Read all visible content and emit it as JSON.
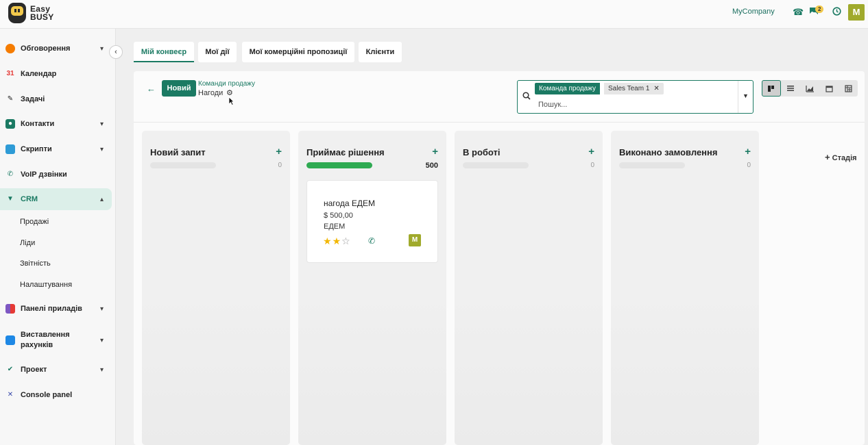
{
  "brand": {
    "line1": "Easy",
    "line2": "BUSY"
  },
  "topbar": {
    "company": "MyCompany",
    "messages_count": "2",
    "avatar": "M"
  },
  "sidebar": {
    "items": [
      {
        "label": "Обговорення",
        "icon": "chat-bubble-icon",
        "color": "#f57c00",
        "chevron": "⌄"
      },
      {
        "label": "Календар",
        "icon": "calendar-icon",
        "color": "#e53935",
        "chevron": ""
      },
      {
        "label": "Задачі",
        "icon": "pen-icon",
        "color": "#1a1a1a",
        "chevron": ""
      },
      {
        "label": "Контакти",
        "icon": "contacts-icon",
        "color": "#1b7a63",
        "chevron": "⌄"
      },
      {
        "label": "Скрипти",
        "icon": "scripts-icon",
        "color": "#2e9bd6",
        "chevron": "⌄"
      },
      {
        "label": "VoIP дзвінки",
        "icon": "phone-icon",
        "color": "#1b7a63",
        "chevron": ""
      },
      {
        "label": "CRM",
        "icon": "crm-icon",
        "color": "#1b7a63",
        "chevron": "⌃"
      },
      {
        "label": "Панелі приладів",
        "icon": "dashboard-icon",
        "color": "#7e57c2",
        "chevron": "⌄"
      },
      {
        "label": "Виставлення",
        "label2": "рахунків",
        "icon": "invoice-icon",
        "color": "#1e88e5",
        "chevron": "⌄"
      },
      {
        "label": "Проект",
        "icon": "check-icon",
        "color": "#1b7a63",
        "chevron": "⌄"
      },
      {
        "label": "Console panel",
        "icon": "tools-icon",
        "color": "#3949ab",
        "chevron": ""
      }
    ],
    "crm_sub": [
      "Продажі",
      "Ліди",
      "Звітність",
      "Налаштування"
    ]
  },
  "tabs": [
    "Мій конвеєр",
    "Мої дії",
    "Мої комерційні пропозиції",
    "Клієнти"
  ],
  "control": {
    "new_label": "Новий",
    "breadcrumb_parent": "Команди продажу",
    "breadcrumb_current": "Нагоди"
  },
  "search": {
    "facet_label": "Команда продажу",
    "facet_value": "Sales Team 1",
    "placeholder": "Пошук..."
  },
  "views": [
    "kanban-view-icon",
    "list-view-icon",
    "graph-view-icon",
    "calendar-view-icon",
    "pivot-view-icon"
  ],
  "columns": [
    {
      "title": "Новий запит",
      "total": "0",
      "progress": 0
    },
    {
      "title": "Приймає рішення",
      "total": "500",
      "progress": 1.0
    },
    {
      "title": "В роботі",
      "total": "0",
      "progress": 0
    },
    {
      "title": "Виконано замовлення",
      "total": "0",
      "progress": 0
    }
  ],
  "card": {
    "title": "нагода ЕДЕМ",
    "amount": "$ 500,00",
    "customer": "ЕДЕМ",
    "stars": 2,
    "stars_max": 3,
    "avatar": "M"
  },
  "add_stage": "Стадія",
  "colors": {
    "accent": "#1b7a63",
    "progress": "#2faa52",
    "star": "#f2b705",
    "avatar": "#a0aa2c"
  }
}
